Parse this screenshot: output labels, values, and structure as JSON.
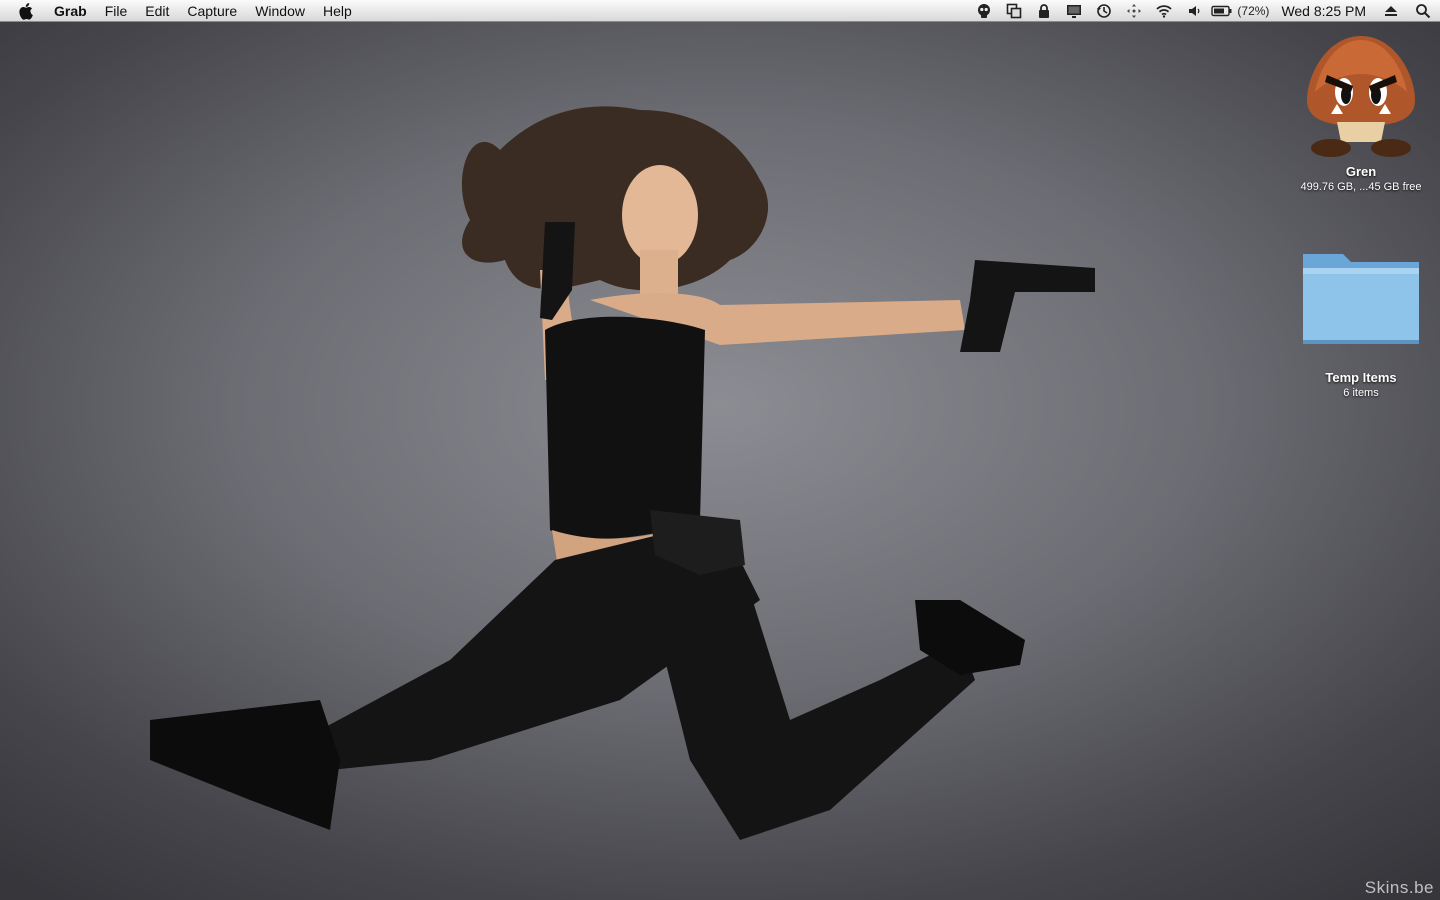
{
  "menubar": {
    "apple_icon": "apple-icon",
    "app_name": "Grab",
    "menus": [
      "File",
      "Edit",
      "Capture",
      "Window",
      "Help"
    ],
    "status_icons": [
      "skull-icon",
      "window-switch-icon",
      "lock-icon",
      "display-icon",
      "time-machine-icon",
      "move-icon",
      "wifi-icon",
      "volume-icon",
      "battery-icon"
    ],
    "battery_percent": "(72%)",
    "clock": "Wed 8:25 PM",
    "eject_icon": "eject-icon",
    "spotlight_icon": "search-icon"
  },
  "desktop": {
    "icons": [
      {
        "name": "Gren",
        "info": "499.76 GB, ...45 GB free",
        "icon": "goomba-drive-icon"
      },
      {
        "name": "Temp Items",
        "info": "6 items",
        "icon": "folder-icon"
      }
    ],
    "watermark": "Skins.be"
  },
  "colors": {
    "wallpaper": "#6c6c73",
    "menubar": "#e6e6e6",
    "folder": "#8ec3ea"
  }
}
